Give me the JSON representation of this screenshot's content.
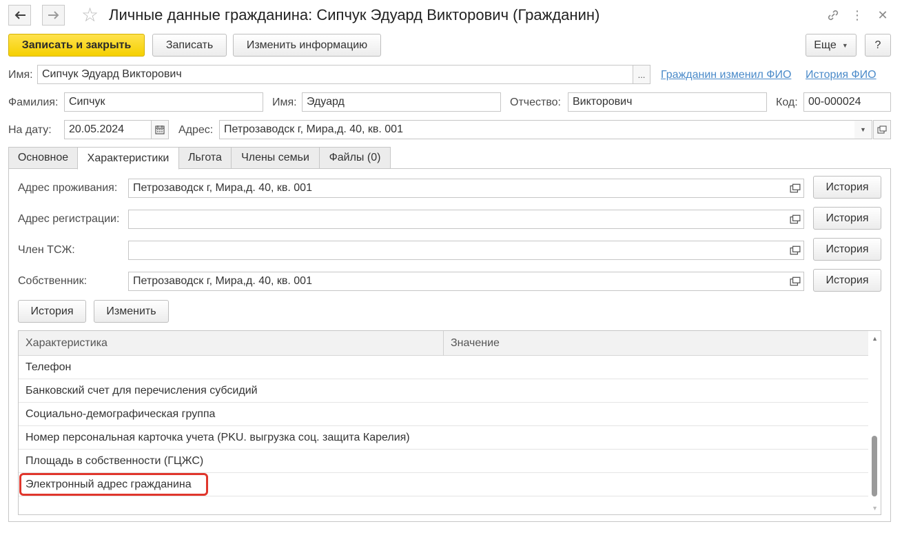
{
  "window": {
    "title": "Личные данные гражданина: Сипчук Эдуард Викторович (Гражданин)",
    "back_icon": "arrow-left-icon",
    "forward_icon": "arrow-right-icon",
    "favorite_icon": "star-icon",
    "link_icon": "link-icon",
    "menu_icon": "kebab-menu-icon",
    "close_icon": "close-icon"
  },
  "toolbar": {
    "save_close_label": "Записать и закрыть",
    "save_label": "Записать",
    "change_info_label": "Изменить информацию",
    "more_label": "Еще",
    "help_label": "?"
  },
  "header": {
    "name_label": "Имя:",
    "name_value": "Сипчук Эдуард Викторович",
    "name_select_label": "...",
    "link_changed_fio": "Гражданин изменил ФИО",
    "link_fio_history": "История ФИО",
    "surname_label": "Фамилия:",
    "surname_value": "Сипчук",
    "first_name_label": "Имя:",
    "first_name_value": "Эдуард",
    "patronymic_label": "Отчество:",
    "patronymic_value": "Викторович",
    "code_label": "Код:",
    "code_value": "00-000024",
    "date_label": "На дату:",
    "date_value": "20.05.2024",
    "address_label": "Адрес:",
    "address_value": "Петрозаводск г, Мира,д. 40, кв. 001"
  },
  "tabs": [
    {
      "label": "Основное",
      "active": false
    },
    {
      "label": "Характеристики",
      "active": true
    },
    {
      "label": "Льгота",
      "active": false
    },
    {
      "label": "Члены семьи",
      "active": false
    },
    {
      "label": "Файлы (0)",
      "active": false
    }
  ],
  "characteristics": {
    "residence_label": "Адрес проживания:",
    "residence_value": "Петрозаводск г, Мира,д. 40, кв. 001",
    "registration_label": "Адрес регистрации:",
    "registration_value": "",
    "hoa_label": "Член ТСЖ:",
    "hoa_value": "",
    "owner_label": "Собственник:",
    "owner_value": "Петрозаводск г, Мира,д. 40, кв. 001",
    "history_label": "История",
    "table_history_label": "История",
    "table_change_label": "Изменить"
  },
  "table": {
    "columns": [
      "Характеристика",
      "Значение"
    ],
    "rows": [
      {
        "name": "Телефон",
        "value": ""
      },
      {
        "name": "Банковский счет для перечисления субсидий",
        "value": ""
      },
      {
        "name": "Социально-демографическая группа",
        "value": ""
      },
      {
        "name": "Номер персональная карточка учета (PKU. выгрузка соц. защита Карелия)",
        "value": ""
      },
      {
        "name": "Площадь в собственности (ГЦЖС)",
        "value": ""
      },
      {
        "name": "Электронный адрес гражданина",
        "value": ""
      }
    ]
  },
  "colors": {
    "primary_button": "#f5d000",
    "link": "#4a8ac9",
    "highlight": "#e0362c"
  }
}
